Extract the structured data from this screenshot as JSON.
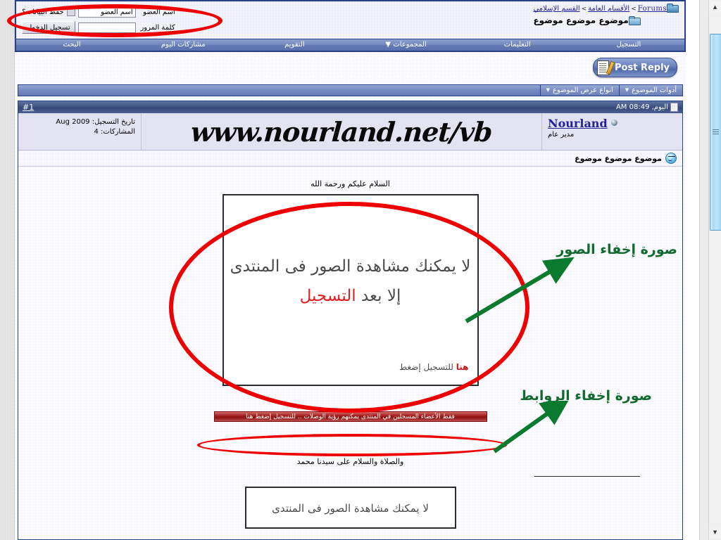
{
  "browser": {
    "scrollbar": {
      "up_arrow": "▲",
      "down_arrow": "▼"
    }
  },
  "login": {
    "username_label": "اسم العضو",
    "username_value": "اسم العضو",
    "remember_label": "حفظ البيانات؟",
    "password_label": "كلمة المرور",
    "password_value": "",
    "submit_label": "تسجيل الدخول"
  },
  "breadcrumb": {
    "root": "Forums",
    "sep": ">",
    "level1": "الأقسام العامة",
    "level2": "القسم الإسلامي",
    "current": "موضوع موضوع موضوع"
  },
  "navbar": {
    "items": [
      {
        "label": "التسجيل"
      },
      {
        "label": "التعليمات"
      },
      {
        "label": "المجموعات ▼"
      },
      {
        "label": "التقويم"
      },
      {
        "label": "مشاركات اليوم"
      },
      {
        "label": "البحث"
      }
    ]
  },
  "toolbar": {
    "post_reply_label": "Post Reply"
  },
  "thread_tools": {
    "tabs": [
      {
        "label": "أدوات الموضوع",
        "caret": "▼"
      },
      {
        "label": "انواع عرض الموضوع",
        "caret": "▼"
      }
    ]
  },
  "post": {
    "number": "#1",
    "date": "اليوم, 08:49 AM",
    "username": "Nourland",
    "usertitle": "مدير عام",
    "watermark": "www.nourland.net/vb",
    "join_date_label": "تاريخ التسجيل:",
    "join_date_value": "Aug 2009",
    "posts_label": "المشاركات:",
    "posts_value": "4",
    "title": "موضوع موضوع موضوع",
    "greeting": "السلام عليكم ورحمة الله",
    "closing": "والصلاة والسلام على سيدنا محمد"
  },
  "hidden_image": {
    "line1": "لا يمكنك مشاهدة الصور فى المنتدى",
    "line2_black": "إلا بعد",
    "line2_red": "التسجيل",
    "line3": "للتسجيل إضغط",
    "line3_mark": "هنا"
  },
  "hidden_image_2": {
    "line1": "لا يمكنك مشاهدة الصور فى المنتدى"
  },
  "link_banner": {
    "text": "فقط الأعضاء المسجلين في المنتدى يمكنهم رؤية الوصلات .. للتسجيل إضغط هنا"
  },
  "annotations": {
    "images_label": "صورة إخفاء الصور",
    "links_label": "صورة إخفاء الروابط",
    "highlight_color": "#ee0000",
    "arrow_color": "#0a7a2e"
  }
}
